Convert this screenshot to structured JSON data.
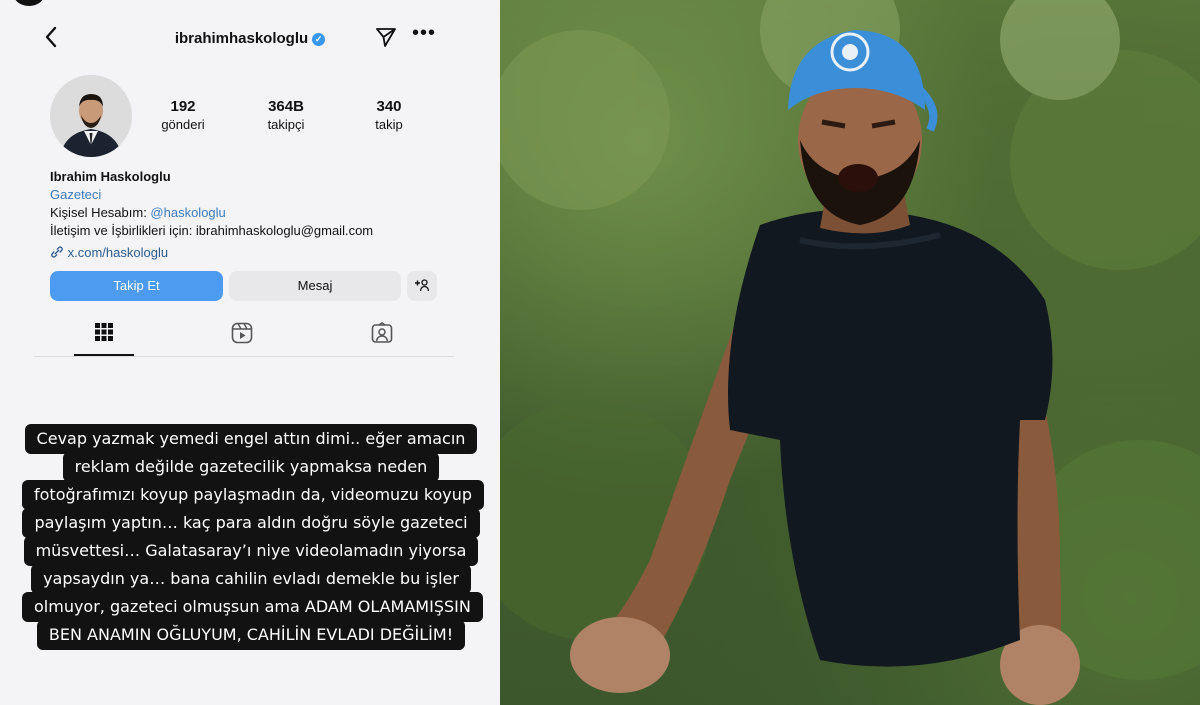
{
  "profile": {
    "username": "ibrahimhaskologlu",
    "stats": [
      {
        "value": "192",
        "label": "gönderi"
      },
      {
        "value": "364B",
        "label": "takipçi"
      },
      {
        "value": "340",
        "label": "takip"
      }
    ],
    "name": "Ibrahim Haskologlu",
    "category": "Gazeteci",
    "bio_personal_prefix": "Kişisel Hesabım: ",
    "bio_personal_handle": "@haskologlu",
    "bio_contact": "İletişim ve İşbirlikleri için: ibrahimhaskologlu@gmail.com",
    "link": "x.com/haskologlu",
    "follow_label": "Takip Et",
    "message_label": "Mesaj",
    "add_person_label": "+👤"
  },
  "tabs": [
    "grid-icon",
    "reels-icon",
    "tagged-icon"
  ],
  "caption_lines": [
    "Cevap yazmak yemedi engel attın dimi.. eğer amacın",
    "reklam değilde gazetecilik yapmaksa neden",
    "fotoğrafımızı koyup paylaşmadın da, videomuzu koyup",
    "paylaşım yaptın… kaç para aldın doğru söyle gazeteci",
    "müsvettesi… Galatasaray’ı niye videolamadın yiyorsa",
    "yapsaydın ya… bana cahilin evladı demekle bu işler",
    "olmuyor, gazeteci olmuşsun ama ADAM OLAMAMIŞSIN",
    "BEN ANAMIN OĞLUYUM, CAHİLİN EVLADI DEĞİLİM!"
  ],
  "colors": {
    "follow_button": "#4c9bf0",
    "verified": "#3897f0",
    "bandana": "#3a8fd8"
  }
}
